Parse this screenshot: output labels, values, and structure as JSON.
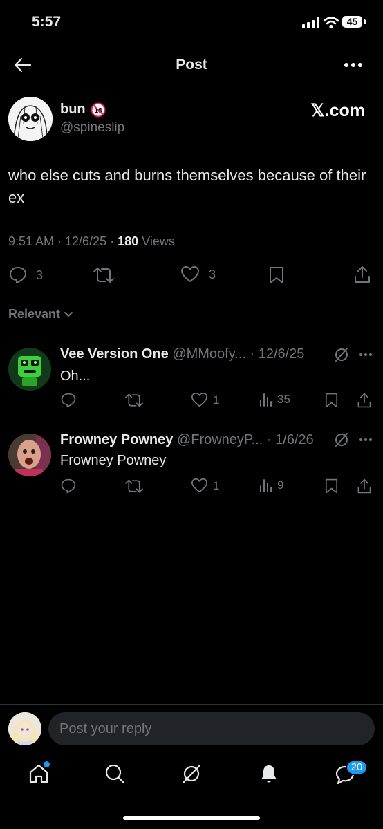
{
  "status_bar": {
    "time": "5:57",
    "battery": "45"
  },
  "header": {
    "title": "Post"
  },
  "post": {
    "display_name": "bun",
    "handle": "@spineslip",
    "source": "𝕏.com",
    "text": "who else cuts and burns themselves because of their ex",
    "timestamp": "9:51 AM · 12/6/25 · ",
    "views_count": "180",
    "views_label": " Views",
    "reply_count": "3",
    "like_count": "3"
  },
  "sort": {
    "label": "Relevant"
  },
  "replies": [
    {
      "display_name": "Vee Version One",
      "meta": "@MMoofy... · 12/6/25",
      "text": "Oh...",
      "like_count": "1",
      "view_count": "35"
    },
    {
      "display_name": "Frowney Powney",
      "meta": "@FrowneyP... · 1/6/26",
      "text": "Frowney Powney",
      "like_count": "1",
      "view_count": "9"
    }
  ],
  "composer": {
    "placeholder": "Post your reply"
  },
  "tab_bar": {
    "messages_badge": "20"
  },
  "colors": {
    "background": "#000000",
    "text": "#e7e9ea",
    "muted": "#71767b",
    "accent": "#1d9bf0"
  }
}
